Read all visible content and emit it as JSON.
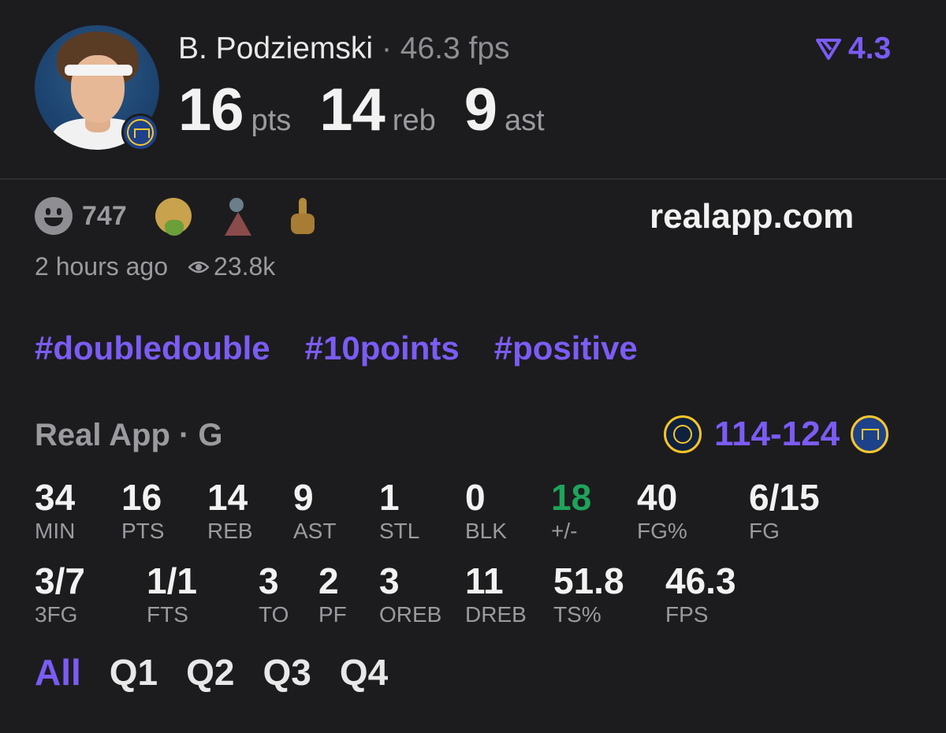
{
  "player": {
    "name": "B. Podziemski",
    "separator": "·",
    "fps": "46.3 fps",
    "rating": "4.3",
    "headline": [
      {
        "value": "16",
        "unit": "pts"
      },
      {
        "value": "14",
        "unit": "reb"
      },
      {
        "value": "9",
        "unit": "ast"
      }
    ]
  },
  "reactions": {
    "count": "747",
    "site": "realapp.com",
    "time": "2 hours ago",
    "views": "23.8k"
  },
  "tags": [
    "#doubledouble",
    "#10points",
    "#positive"
  ],
  "game": {
    "title": "Real App · G",
    "score": "114-124"
  },
  "stats_row1": [
    {
      "value": "34",
      "label": "MIN"
    },
    {
      "value": "16",
      "label": "PTS"
    },
    {
      "value": "14",
      "label": "REB"
    },
    {
      "value": "9",
      "label": "AST"
    },
    {
      "value": "1",
      "label": "STL"
    },
    {
      "value": "0",
      "label": "BLK"
    },
    {
      "value": "18",
      "label": "+/-"
    },
    {
      "value": "40",
      "label": "FG%"
    },
    {
      "value": "6/15",
      "label": "FG"
    }
  ],
  "stats_row2": [
    {
      "value": "3/7",
      "label": "3FG"
    },
    {
      "value": "1/1",
      "label": "FTS"
    },
    {
      "value": "3",
      "label": "TO"
    },
    {
      "value": "2",
      "label": "PF"
    },
    {
      "value": "3",
      "label": "OREB"
    },
    {
      "value": "11",
      "label": "DREB"
    },
    {
      "value": "51.8",
      "label": "TS%"
    },
    {
      "value": "46.3",
      "label": "FPS"
    }
  ],
  "tabs": [
    "All",
    "Q1",
    "Q2",
    "Q3",
    "Q4"
  ],
  "active_tab": "All",
  "colors": {
    "accent": "#7b5cf5",
    "positive": "#1fa35c",
    "background": "#1c1c1e"
  }
}
